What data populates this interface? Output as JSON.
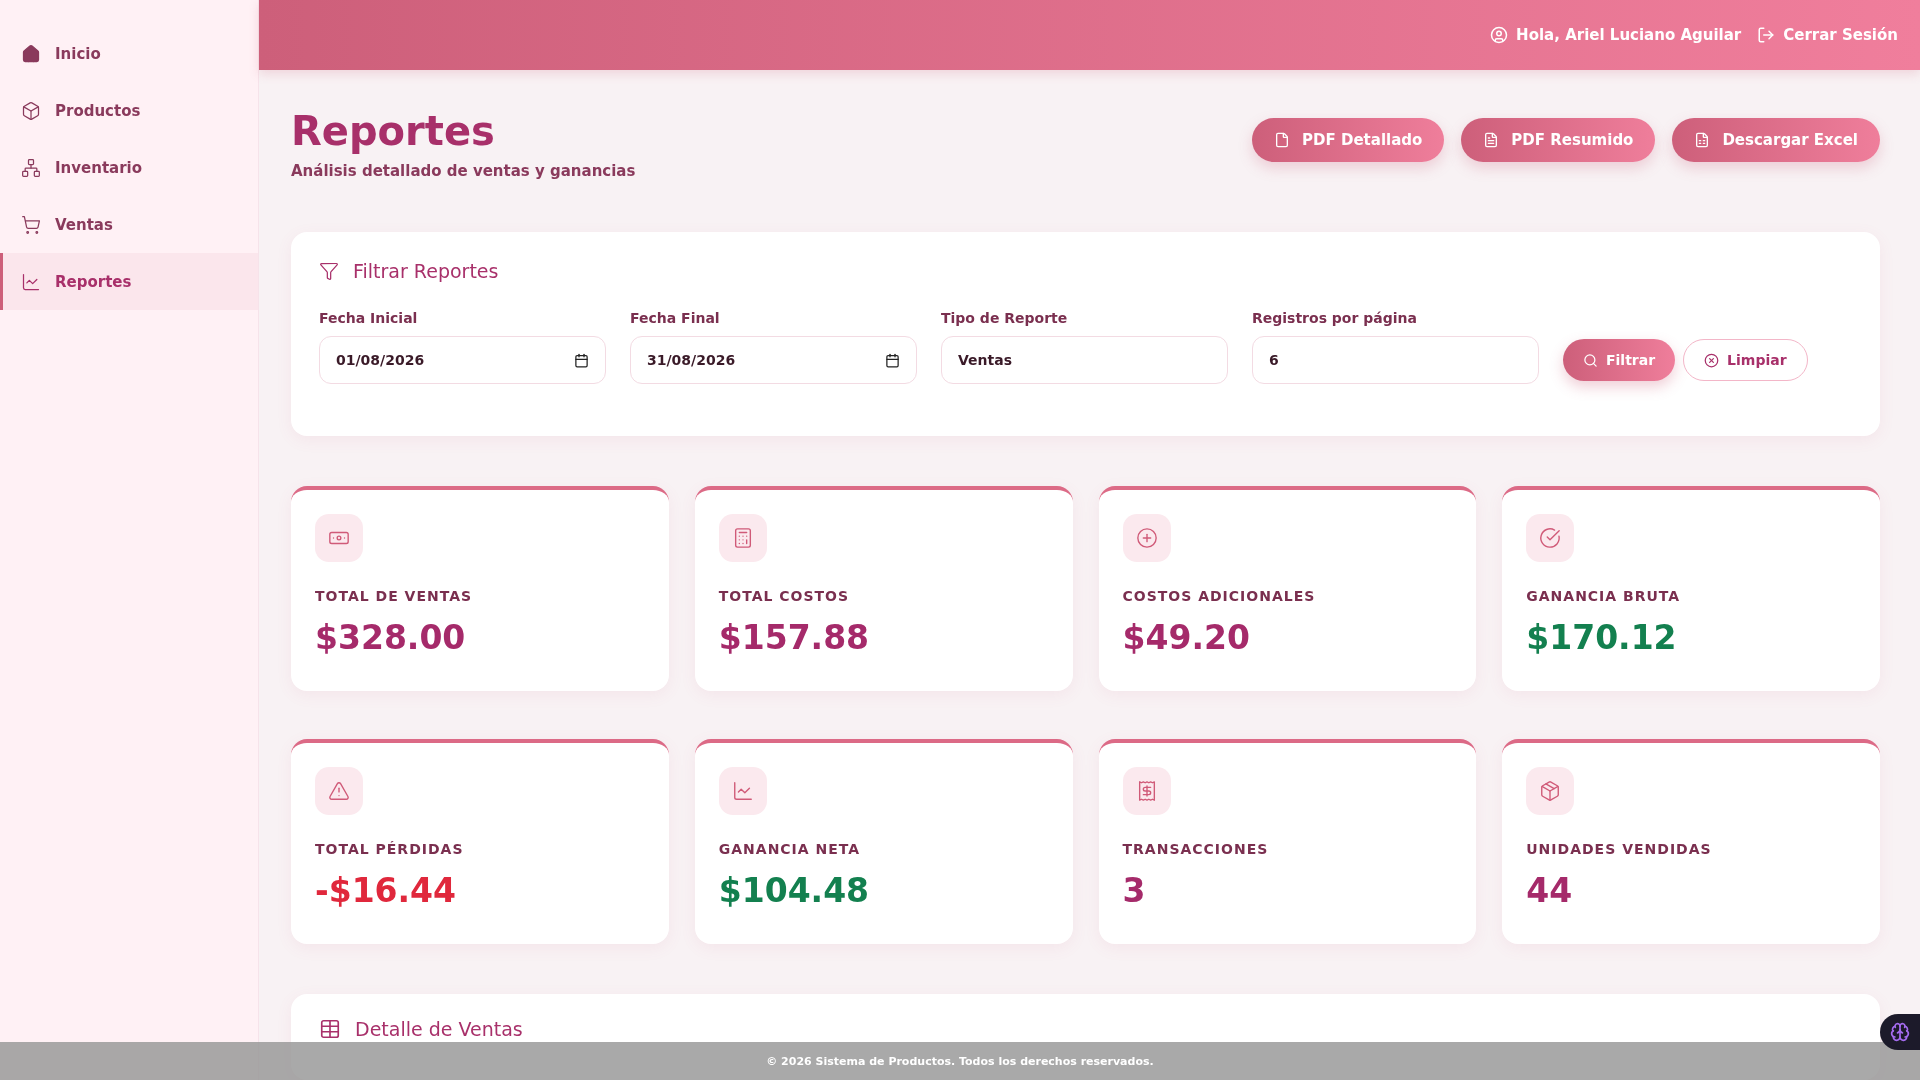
{
  "sidebar": {
    "items": [
      {
        "label": "Inicio",
        "selected": false
      },
      {
        "label": "Productos",
        "selected": false
      },
      {
        "label": "Inventario",
        "selected": false
      },
      {
        "label": "Ventas",
        "selected": false
      },
      {
        "label": "Reportes",
        "selected": true
      }
    ]
  },
  "header": {
    "greeting": "Hola, Ariel Luciano Aguilar",
    "logout": "Cerrar Sesión"
  },
  "page": {
    "title": "Reportes",
    "subtitle": "Análisis detallado de ventas y ganancias"
  },
  "actions": [
    "PDF Detallado",
    "PDF Resumido",
    "Descargar Excel"
  ],
  "filter": {
    "title": "Filtrar Reportes",
    "fields": [
      {
        "label": "Fecha Inicial",
        "value": "01/08/2026",
        "kind": "date"
      },
      {
        "label": "Fecha Final",
        "value": "31/08/2026",
        "kind": "date"
      },
      {
        "label": "Tipo de Reporte",
        "value": "Ventas",
        "kind": "select"
      },
      {
        "label": "Registros por página",
        "value": "6",
        "kind": "number"
      }
    ],
    "apply": "Filtrar",
    "clear": "Limpiar"
  },
  "stats": [
    {
      "label": "TOTAL DE VENTAS",
      "value": "$328.00",
      "color": "#a52a6a"
    },
    {
      "label": "TOTAL COSTOS",
      "value": "$157.88",
      "color": "#a52a6a"
    },
    {
      "label": "COSTOS ADICIONALES",
      "value": "$49.20",
      "color": "#a52a6a"
    },
    {
      "label": "GANANCIA BRUTA",
      "value": "$170.12",
      "color": "#13804f"
    },
    {
      "label": "TOTAL PÉRDIDAS",
      "value": "-$16.44",
      "color": "#e0283c"
    },
    {
      "label": "GANANCIA NETA",
      "value": "$104.48",
      "color": "#13804f"
    },
    {
      "label": "TRANSACCIONES",
      "value": "3",
      "color": "#a52a6a"
    },
    {
      "label": "UNIDADES VENDIDAS",
      "value": "44",
      "color": "#a52a6a"
    }
  ],
  "detail": {
    "title": "Detalle de Ventas"
  },
  "footer": "© 2026 Sistema de Productos. Todos los derechos reservados."
}
